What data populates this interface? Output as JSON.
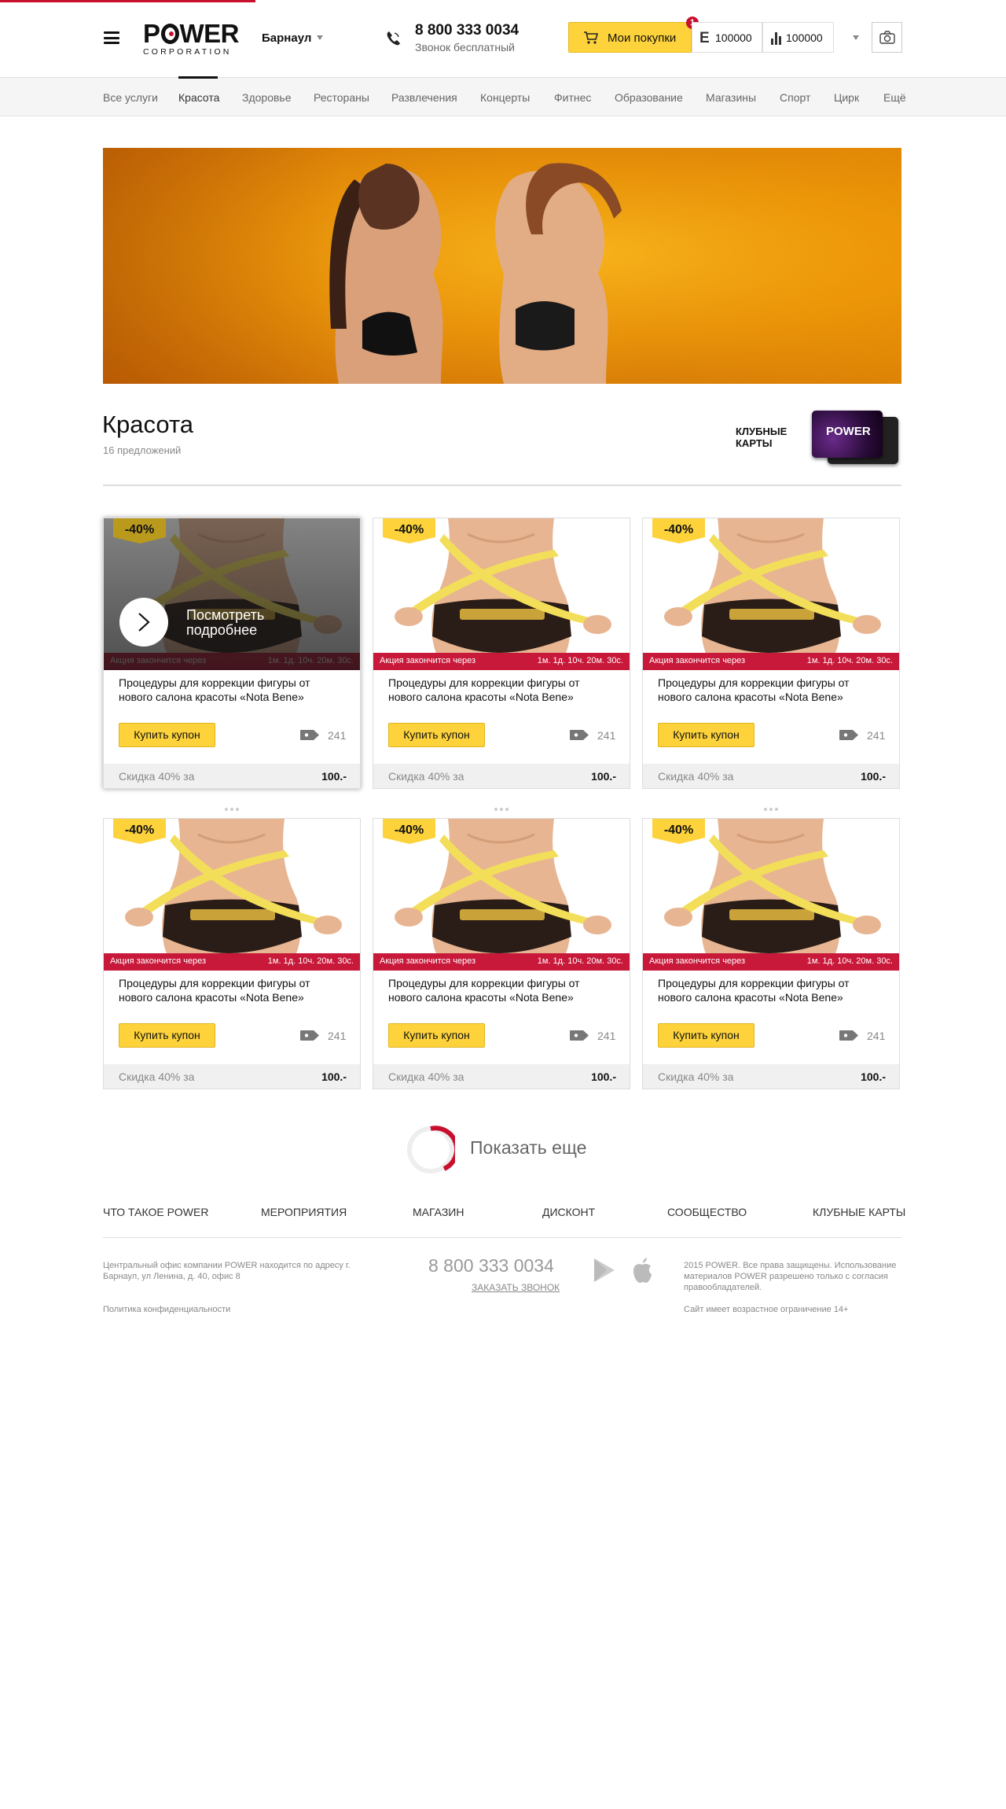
{
  "header": {
    "logo_text": "POWER",
    "logo_sub": "CORPORATION",
    "city": "Барнаул",
    "phone": "8 800 333 0034",
    "phone_note": "Звонок бесплатный",
    "cart_label": "Мои покупки",
    "cart_badge": "1",
    "counter1_icon": "Е",
    "counter1_value": "100000",
    "counter2_value": "100000",
    "icons": [
      "menu-icon",
      "phone-icon",
      "cart-icon",
      "bars-icon",
      "camera-icon",
      "chevron-down-icon"
    ]
  },
  "nav": {
    "items": [
      {
        "label": "Все услуги"
      },
      {
        "label": "Красота"
      },
      {
        "label": "Здоровье"
      },
      {
        "label": "Рестораны"
      },
      {
        "label": "Развлечения"
      },
      {
        "label": "Концерты"
      },
      {
        "label": "Фитнес"
      },
      {
        "label": "Образование"
      },
      {
        "label": "Магазины"
      },
      {
        "label": "Спорт"
      },
      {
        "label": "Цирк"
      },
      {
        "label": "Ещё"
      }
    ],
    "active": "Красота"
  },
  "section": {
    "title": "Красота",
    "subtitle": "16 предложений",
    "club_label": "КЛУБНЫЕ КАРТЫ",
    "club_card_logo": "POWER"
  },
  "products": [
    {
      "discount": "-40%",
      "timer_label": "Акция закончится через",
      "timer_value": "1м. 1д. 10ч. 20м. 30с.",
      "title": "Процедуры для коррекции фигуры от нового салона красоты «Nota Bene»",
      "buy_label": "Купить купон",
      "count": "241",
      "price_label": "Скидка 40% за",
      "price": "100.-",
      "overlay_text": "Посмотреть подробнее"
    },
    {
      "discount": "-40%",
      "timer_label": "Акция закончится через",
      "timer_value": "1м. 1д. 10ч. 20м. 30с.",
      "title": "Процедуры для коррекции фигуры от нового салона красоты «Nota Bene»",
      "buy_label": "Купить купон",
      "count": "241",
      "price_label": "Скидка 40% за",
      "price": "100.-"
    },
    {
      "discount": "-40%",
      "timer_label": "Акция закончится через",
      "timer_value": "1м. 1д. 10ч. 20м. 30с.",
      "title": "Процедуры для коррекции фигуры от нового салона красоты «Nota Bene»",
      "buy_label": "Купить купон",
      "count": "241",
      "price_label": "Скидка 40% за",
      "price": "100.-"
    },
    {
      "discount": "-40%",
      "timer_label": "Акция закончится через",
      "timer_value": "1м. 1д. 10ч. 20м. 30с.",
      "title": "Процедуры для коррекции фигуры от нового салона красоты «Nota Bene»",
      "buy_label": "Купить купон",
      "count": "241",
      "price_label": "Скидка 40% за",
      "price": "100.-"
    },
    {
      "discount": "-40%",
      "timer_label": "Акция закончится через",
      "timer_value": "1м. 1д. 10ч. 20м. 30с.",
      "title": "Процедуры для коррекции фигуры от нового салона красоты «Nota Bene»",
      "buy_label": "Купить купон",
      "count": "241",
      "price_label": "Скидка 40% за",
      "price": "100.-"
    },
    {
      "discount": "-40%",
      "timer_label": "Акция закончится через",
      "timer_value": "1м. 1д. 10ч. 20м. 30с.",
      "title": "Процедуры для коррекции фигуры от нового салона красоты «Nota Bene»",
      "buy_label": "Купить купон",
      "count": "241",
      "price_label": "Скидка 40% за",
      "price": "100.-"
    }
  ],
  "show_more": {
    "label": "Показать еще"
  },
  "footer": {
    "nav": [
      "ЧТО ТАКОЕ POWER",
      "МЕРОПРИЯТИЯ",
      "МАГАЗИН",
      "ДИСКОНТ",
      "СООБЩЕСТВО",
      "КЛУБНЫЕ КАРТЫ"
    ],
    "address": "Центральный офис компании POWER находится по адресу г. Барнаул, ул Ленина, д. 40, офис 8",
    "privacy": "Политика конфиденциальности",
    "phone": "8 800 333 0034",
    "call_label": "ЗАКАЗАТЬ ЗВОНОК",
    "copyright": "2015 POWER. Все права защищены. Использование материалов POWER разрешено только с согласия правообладателей.",
    "age_note": "Сайт имеет возрастное ограничение 14+"
  },
  "colors": {
    "accent": "#c8102e",
    "button": "#fdd23b",
    "timer": "#c8193a"
  }
}
